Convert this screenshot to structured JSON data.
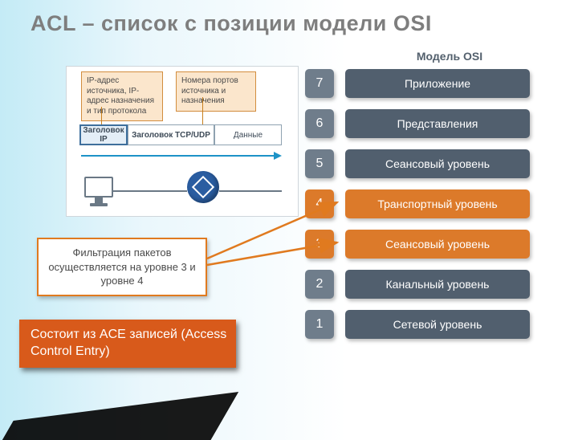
{
  "title": "ACL – список с позиции модели OSI",
  "osi": {
    "heading": "Модель OSI",
    "layers": [
      {
        "num": "7",
        "label": "Приложение",
        "highlight": false
      },
      {
        "num": "6",
        "label": "Представления",
        "highlight": false
      },
      {
        "num": "5",
        "label": "Сеансовый уровень",
        "highlight": false
      },
      {
        "num": "4",
        "label": "Транспортный уровень",
        "highlight": true
      },
      {
        "num": "3",
        "label": "Сеансовый уровень",
        "highlight": true
      },
      {
        "num": "2",
        "label": "Канальный уровень",
        "highlight": false
      },
      {
        "num": "1",
        "label": "Сетевой уровень",
        "highlight": false
      }
    ]
  },
  "packet": {
    "callout_ip": "IP-адрес источника, IP-адрес назначения и тип протокола",
    "callout_port": "Номера портов источника и назначения",
    "hdr_ip": "Заголовок IP",
    "hdr_tcp": "Заголовок TCP/UDP",
    "hdr_data": "Данные"
  },
  "filter_note": "Фильтрация пакетов осуществляется на уровне 3 и уровне 4",
  "ace_note": "Состоит из ACE записей (Access Control Entry)",
  "icons": {
    "pc": "pc-icon",
    "router": "router-icon"
  }
}
